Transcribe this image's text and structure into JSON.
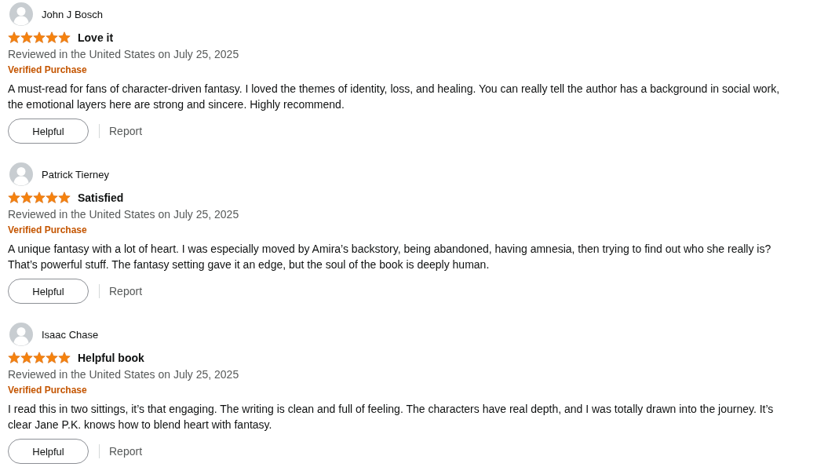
{
  "reviews": [
    {
      "author": "John J Bosch",
      "stars": 5,
      "title": "Love it",
      "date": "Reviewed in the United States on July 25, 2025",
      "badge": "Verified Purchase",
      "body": "A must-read for fans of character-driven fantasy. I loved the themes of identity, loss, and healing. You can really tell the author has a background in social work, the emotional layers here are strong and sincere. Highly recommend.",
      "helpful": "Helpful",
      "report": "Report"
    },
    {
      "author": "Patrick Tierney",
      "stars": 5,
      "title": "Satisfied",
      "date": "Reviewed in the United States on July 25, 2025",
      "badge": "Verified Purchase",
      "body": "A unique fantasy with a lot of heart. I was especially moved by Amira’s backstory, being abandoned, having amnesia, then trying to find out who she really is? That’s powerful stuff. The fantasy setting gave it an edge, but the soul of the book is deeply human.",
      "helpful": "Helpful",
      "report": "Report"
    },
    {
      "author": "Isaac Chase",
      "stars": 5,
      "title": "Helpful book",
      "date": "Reviewed in the United States on July 25, 2025",
      "badge": "Verified Purchase",
      "body": "I read this in two sittings, it’s that engaging. The writing is clean and full of feeling. The characters have real depth, and I was totally drawn into the journey. It’s clear Jane P.K. knows how to blend heart with fantasy.",
      "helpful": "Helpful",
      "report": "Report"
    }
  ]
}
